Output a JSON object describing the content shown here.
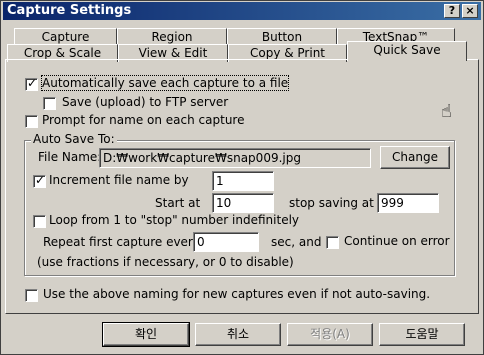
{
  "window": {
    "title": "Capture Settings"
  },
  "title_buttons": {
    "help": "?",
    "close": "×"
  },
  "tabs": {
    "row1": [
      "Capture",
      "Region",
      "Button",
      "TextSnap™"
    ],
    "row2": [
      "Crop & Scale",
      "View & Edit",
      "Copy & Print",
      "Quick Save"
    ],
    "active": "Quick Save"
  },
  "options": {
    "auto_save": {
      "label": "Automatically save each capture to a file",
      "checked": true
    },
    "ftp": {
      "label": "Save (upload) to FTP server",
      "checked": false
    },
    "prompt": {
      "label": "Prompt for name on each capture",
      "checked": false
    }
  },
  "autosave": {
    "group_title": "Auto Save To:",
    "file_name_label": "File Name:",
    "file_name_value": "D:₩work₩capture₩snap009.jpg",
    "change_button": "Change",
    "increment": {
      "label": "Increment file name by",
      "checked": true,
      "value": "1"
    },
    "start_at": {
      "label": "Start at",
      "value": "10"
    },
    "stop_at": {
      "label": "stop saving at",
      "value": "999"
    },
    "loop": {
      "label": "Loop from 1 to \"stop\" number indefinitely",
      "checked": false
    },
    "repeat": {
      "label": "Repeat first capture every",
      "value": "0",
      "unit": "sec, and"
    },
    "continue_error": {
      "label": "Continue on error",
      "checked": false
    },
    "hint": "(use fractions if necessary, or 0 to disable)"
  },
  "use_naming": {
    "label": "Use the above naming for new captures even if not auto-saving.",
    "checked": false
  },
  "buttons": {
    "ok": "확인",
    "cancel": "취소",
    "apply": "적용(A)",
    "help": "도움말"
  }
}
